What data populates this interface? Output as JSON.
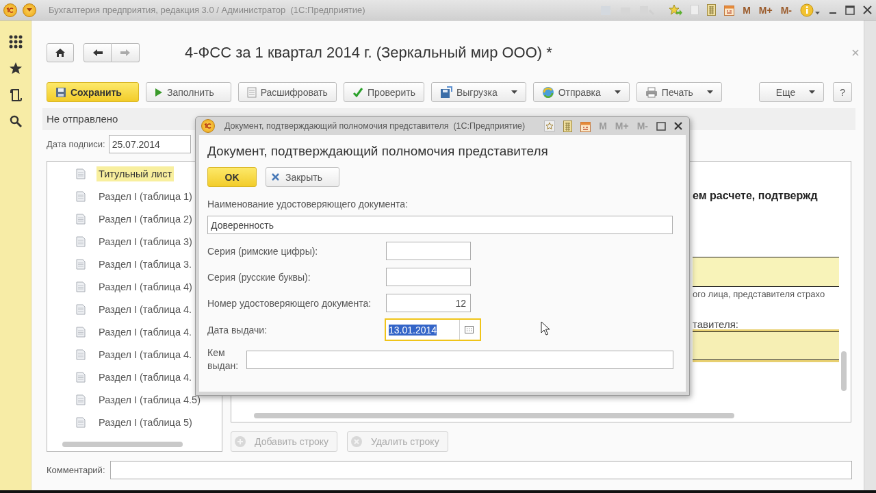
{
  "app_window": {
    "title": "Бухгалтерия предприятия, редакция 3.0 / Администратор  (1С:Предприятие)",
    "memory_buttons": [
      {
        "label": "M",
        "disabled": false
      },
      {
        "label": "M+",
        "disabled": false
      },
      {
        "label": "M-",
        "disabled": false
      }
    ]
  },
  "form": {
    "title": "4-ФСС за 1 квартал 2014 г. (Зеркальный мир ООО) *",
    "toolbar": [
      {
        "label": "Сохранить",
        "kind": "save",
        "dropdown": false
      },
      {
        "label": "Заполнить",
        "kind": "fill",
        "dropdown": false
      },
      {
        "label": "Расшифровать",
        "kind": "decode",
        "dropdown": false
      },
      {
        "label": "Проверить",
        "kind": "check",
        "dropdown": false
      },
      {
        "label": "Выгрузка",
        "kind": "export",
        "dropdown": true
      },
      {
        "label": "Отправка",
        "kind": "send",
        "dropdown": true
      },
      {
        "label": "Печать",
        "kind": "print",
        "dropdown": true
      },
      {
        "label": "Еще",
        "kind": "more",
        "dropdown": true
      },
      {
        "label": "?",
        "kind": "help",
        "dropdown": false
      }
    ],
    "status": "Не отправлено",
    "sign_date": {
      "label": "Дата подписи:",
      "value": "25.07.2014"
    },
    "sections": [
      {
        "label": "Титульный лист",
        "selected": true
      },
      {
        "label": "Раздел I (таблица 1)",
        "selected": false
      },
      {
        "label": "Раздел I (таблица 2)",
        "selected": false
      },
      {
        "label": "Раздел I (таблица 3)",
        "selected": false
      },
      {
        "label": "Раздел I (таблица 3.",
        "selected": false
      },
      {
        "label": "Раздел I (таблица 4)",
        "selected": false
      },
      {
        "label": "Раздел I (таблица 4.",
        "selected": false
      },
      {
        "label": "Раздел I (таблица 4.",
        "selected": false
      },
      {
        "label": "Раздел I (таблица 4.",
        "selected": false
      },
      {
        "label": "Раздел I (таблица 4.",
        "selected": false
      },
      {
        "label": "Раздел I (таблица 4.5)",
        "selected": false
      },
      {
        "label": "Раздел I (таблица 5)",
        "selected": false
      }
    ],
    "report": {
      "heading": "ем расчете, подтвержд",
      "caption": "ого лица, представителя страхо",
      "field_label": "тавителя:"
    },
    "row_buttons": [
      {
        "label": "Добавить строку",
        "kind": "add",
        "disabled": true
      },
      {
        "label": "Удалить строку",
        "kind": "delete",
        "disabled": true
      }
    ],
    "comment": {
      "label": "Комментарий:"
    }
  },
  "dialog": {
    "window_title": "Документ, подтверждающий полномочия представителя  (1С:Предприятие)",
    "memory_buttons": [
      {
        "label": "M",
        "disabled": true
      },
      {
        "label": "M+",
        "disabled": true
      },
      {
        "label": "M-",
        "disabled": true
      }
    ],
    "title": "Документ, подтверждающий полномочия представителя",
    "buttons": [
      {
        "label": "OK",
        "kind": "default"
      },
      {
        "label": "Закрыть",
        "kind": "close"
      }
    ],
    "fields": [
      {
        "label": "Наименование удостоверяющего документа:",
        "value": "Доверенность",
        "kind": "wide",
        "focused": false
      },
      {
        "label": "Серия (римские цифры):",
        "kind": "short",
        "focused": false
      },
      {
        "label": "Серия (русские буквы):",
        "kind": "short",
        "focused": false
      },
      {
        "label": "Номер удостоверяющего документа:",
        "value": "12",
        "kind": "number",
        "focused": false
      },
      {
        "label": "Дата выдачи:",
        "value": "13.01.2014",
        "kind": "date",
        "focused": true
      },
      {
        "label": "Кем выдан:",
        "kind": "inline",
        "focused": false
      }
    ]
  }
}
